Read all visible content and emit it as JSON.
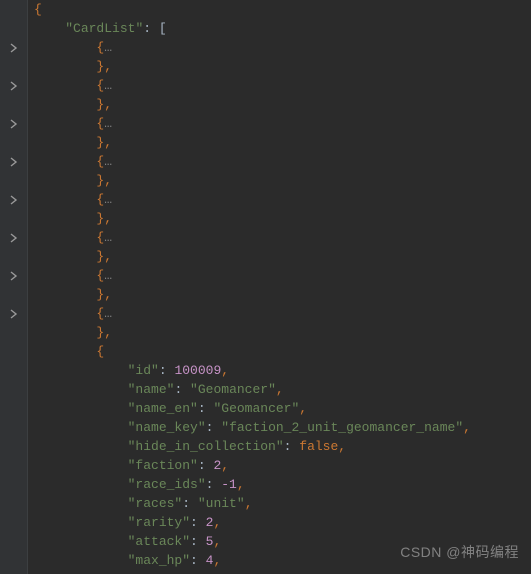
{
  "root_key": "CardList",
  "collapsed_count": 8,
  "folded_placeholder": "…",
  "expanded_item": {
    "id": 100009,
    "name": "Geomancer",
    "name_en": "Geomancer",
    "name_key": "faction_2_unit_geomancer_name",
    "hide_in_collection": false,
    "faction": 2,
    "race_ids": -1,
    "races": "unit",
    "rarity": 2,
    "attack": 5,
    "max_hp": 4
  },
  "watermark": "CSDN @神码编程"
}
